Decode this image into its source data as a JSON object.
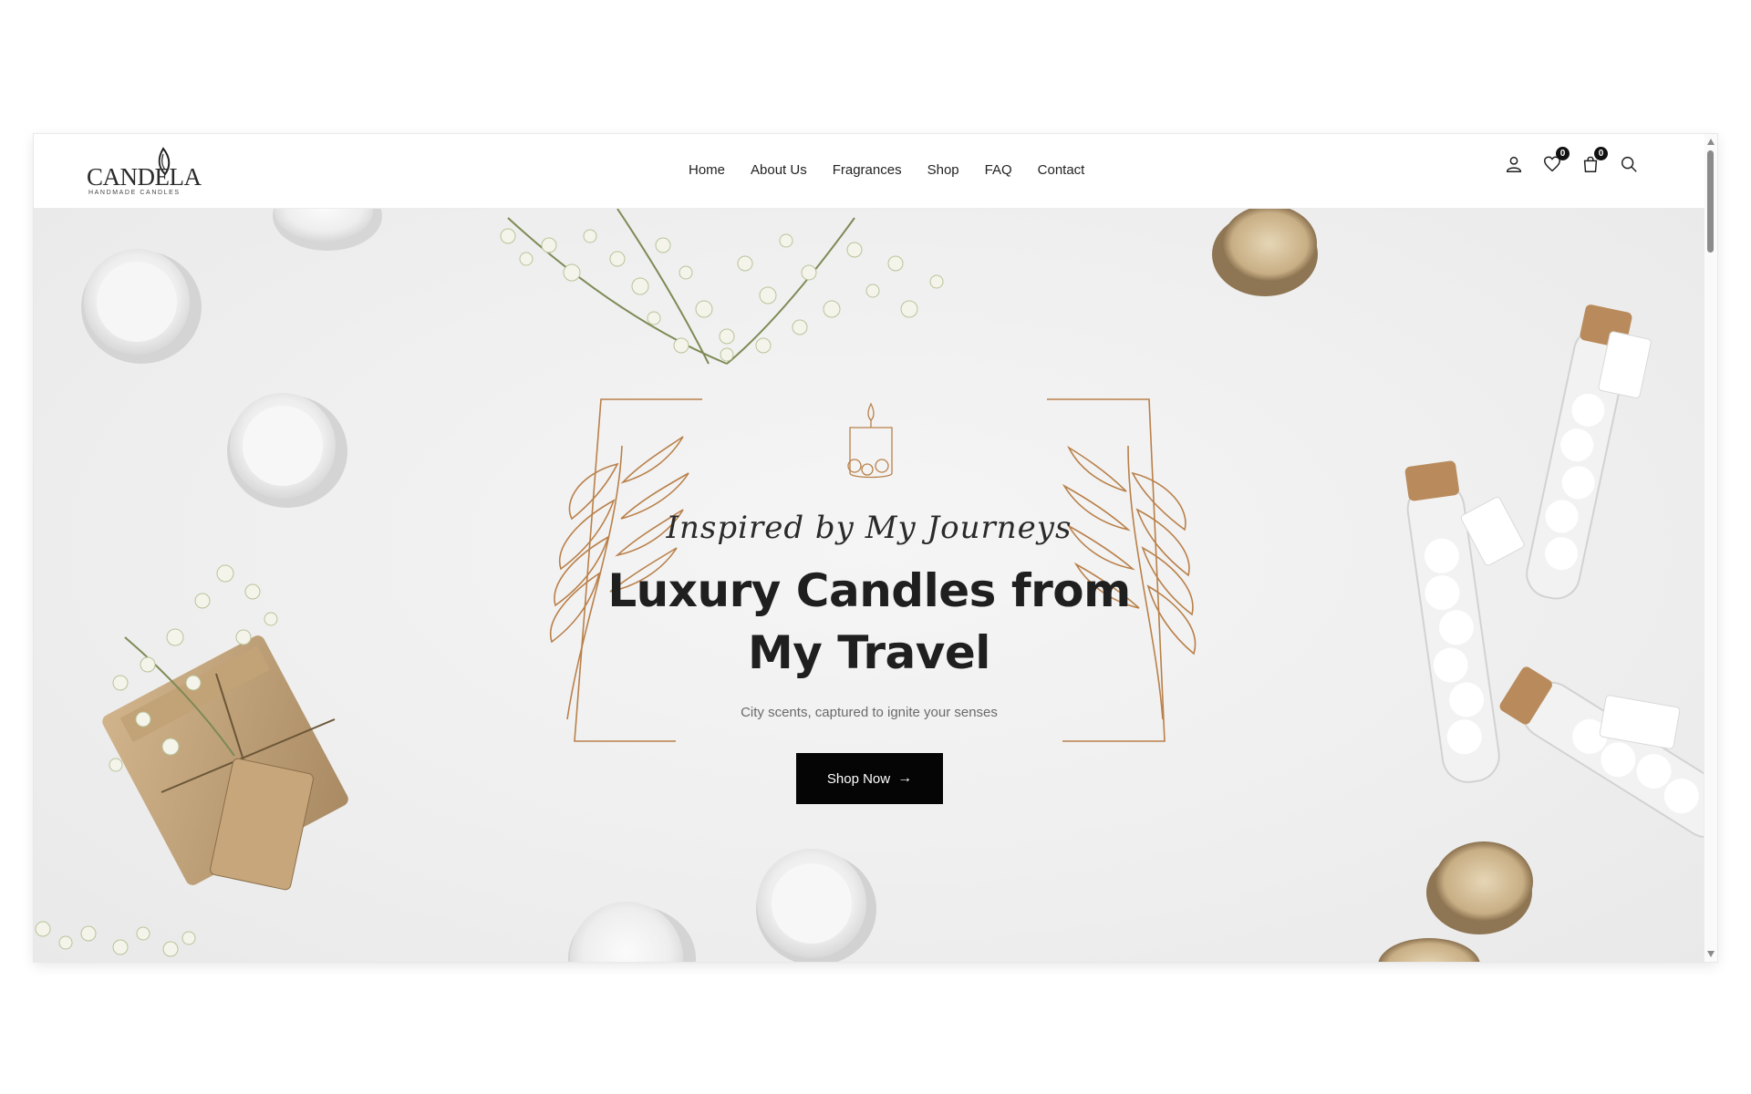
{
  "brand": {
    "name": "CANDELA",
    "tagline": "HANDMADE CANDLES"
  },
  "nav": {
    "items": [
      "Home",
      "About Us",
      "Fragrances",
      "Shop",
      "FAQ",
      "Contact"
    ]
  },
  "header_icons": {
    "account": "user-icon",
    "wishlist": "heart-icon",
    "wishlist_count": "0",
    "cart": "shopping-bag-icon",
    "cart_count": "0",
    "search": "search-icon"
  },
  "hero": {
    "script_line": "Inspired by My Journeys",
    "title_line1": "Luxury Candles from",
    "title_line2": "My Travel",
    "subtitle": "City scents, captured to ignite your senses",
    "cta_label": "Shop Now",
    "cta_icon": "arrow-right-icon"
  },
  "colors": {
    "accent_line": "#b9804a",
    "button_bg": "#050505",
    "text_dark": "#1f1f1f"
  }
}
